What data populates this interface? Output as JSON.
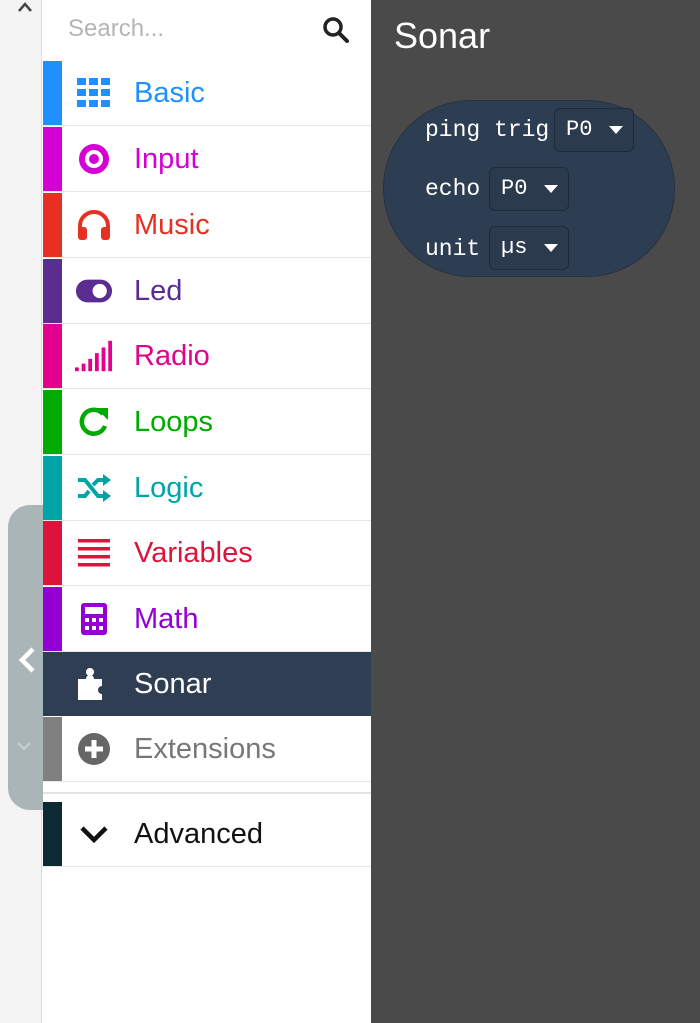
{
  "search": {
    "placeholder": "Search..."
  },
  "categories": [
    {
      "id": "basic",
      "label": "Basic",
      "color": "#1E90FF",
      "icon": "grid-icon"
    },
    {
      "id": "input",
      "label": "Input",
      "color": "#D400D4",
      "icon": "radio-button-icon"
    },
    {
      "id": "music",
      "label": "Music",
      "color": "#E63022",
      "icon": "headphones-icon"
    },
    {
      "id": "led",
      "label": "Led",
      "color": "#5C2D91",
      "icon": "toggle-icon"
    },
    {
      "id": "radio",
      "label": "Radio",
      "color": "#E3008C",
      "icon": "signal-bars-icon"
    },
    {
      "id": "loops",
      "label": "Loops",
      "color": "#00AA00",
      "icon": "refresh-icon"
    },
    {
      "id": "logic",
      "label": "Logic",
      "color": "#00A4A6",
      "icon": "shuffle-icon"
    },
    {
      "id": "variables",
      "label": "Variables",
      "color": "#DC143C",
      "icon": "lines-icon"
    },
    {
      "id": "math",
      "label": "Math",
      "color": "#9400D3",
      "icon": "calculator-icon"
    },
    {
      "id": "sonar",
      "label": "Sonar",
      "color": "#2F3E52",
      "icon": "puzzle-icon",
      "selected": true
    },
    {
      "id": "extensions",
      "label": "Extensions",
      "color": "#808080",
      "icon": "plus-circle-icon"
    }
  ],
  "advanced": {
    "label": "Advanced",
    "color": "#0B2A33",
    "icon": "chevron-down-icon"
  },
  "flyout": {
    "title": "Sonar",
    "block": {
      "line1_text": "ping trig",
      "trig_value": "P0",
      "line2_text": "echo",
      "echo_value": "P0",
      "line3_text": "unit",
      "unit_value": "µs"
    }
  }
}
